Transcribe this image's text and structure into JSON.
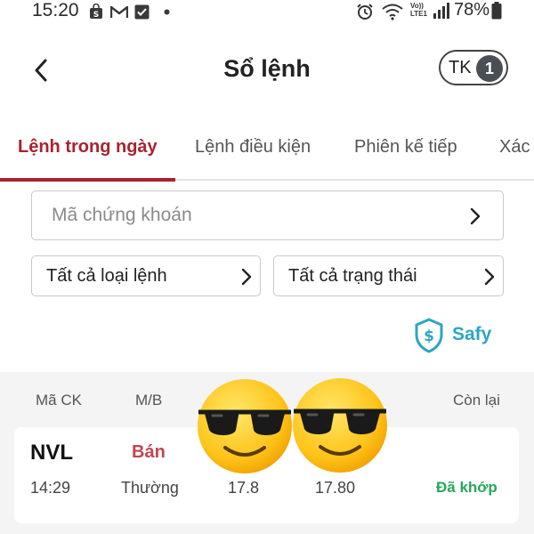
{
  "status_bar": {
    "time": "15:20",
    "notification_icons": [
      "shopee-bag-icon",
      "gmail-icon",
      "check-box-icon",
      "dot-icon"
    ],
    "volte_text": "Vo))\nLTE1",
    "battery_text": "78%"
  },
  "header": {
    "title": "Sổ lệnh",
    "account_label": "TK",
    "account_number": "1"
  },
  "tabs": [
    {
      "label": "Lệnh trong ngày",
      "active": true
    },
    {
      "label": "Lệnh điều kiện",
      "active": false
    },
    {
      "label": "Phiên kế tiếp",
      "active": false
    },
    {
      "label": "Xác",
      "active": false
    }
  ],
  "search": {
    "placeholder": "Mã chứng khoán"
  },
  "filters": {
    "order_type": "Tất cả loại lệnh",
    "status": "Tất cả trạng thái"
  },
  "safy": {
    "label": "Safy"
  },
  "table": {
    "headers": {
      "symbol": "Mã CK",
      "side": "M/B",
      "remaining": "Còn lại"
    },
    "rows": [
      {
        "symbol": "NVL",
        "side": "Bán",
        "time": "14:29",
        "order_type": "Thường",
        "price": "17.8",
        "matched_price": "17.80",
        "status": "Đã khớp"
      }
    ]
  },
  "colors": {
    "accent": "#a8232f",
    "sell": "#c0474f",
    "matched": "#27a85a",
    "safy": "#2fa4c7"
  },
  "overlays": [
    "sunglasses-emoji",
    "sunglasses-emoji"
  ]
}
